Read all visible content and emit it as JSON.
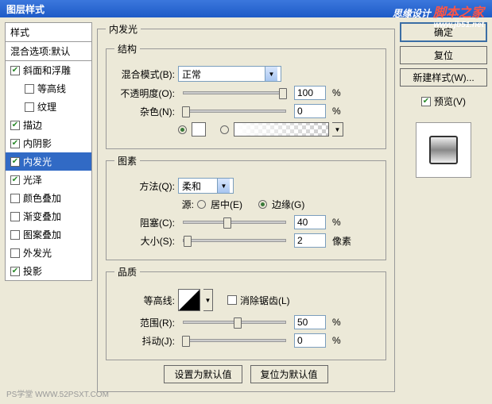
{
  "title": "图层样式",
  "watermark": {
    "text1": "思缘设计",
    "text2": "脚本之家",
    "url": "www.jb51.net"
  },
  "styles": {
    "header": "样式",
    "sub": "混合选项:默认",
    "items": [
      {
        "label": "斜面和浮雕",
        "checked": true
      },
      {
        "label": "等高线",
        "checked": false,
        "indent": true
      },
      {
        "label": "纹理",
        "checked": false,
        "indent": true
      },
      {
        "label": "描边",
        "checked": true
      },
      {
        "label": "内阴影",
        "checked": true
      },
      {
        "label": "内发光",
        "checked": true,
        "selected": true
      },
      {
        "label": "光泽",
        "checked": true
      },
      {
        "label": "颜色叠加",
        "checked": false
      },
      {
        "label": "渐变叠加",
        "checked": false
      },
      {
        "label": "图案叠加",
        "checked": false
      },
      {
        "label": "外发光",
        "checked": false
      },
      {
        "label": "投影",
        "checked": true
      }
    ]
  },
  "panel": {
    "title": "内发光",
    "structure": {
      "legend": "结构",
      "blendMode": {
        "label": "混合模式(B):",
        "value": "正常"
      },
      "opacity": {
        "label": "不透明度(O):",
        "value": "100",
        "unit": "%"
      },
      "noise": {
        "label": "杂色(N):",
        "value": "0",
        "unit": "%"
      }
    },
    "elements": {
      "legend": "图素",
      "technique": {
        "label": "方法(Q):",
        "value": "柔和"
      },
      "source": {
        "label": "源:",
        "center": "居中(E)",
        "edge": "边缘(G)"
      },
      "choke": {
        "label": "阻塞(C):",
        "value": "40",
        "unit": "%"
      },
      "size": {
        "label": "大小(S):",
        "value": "2",
        "unit": "像素"
      }
    },
    "quality": {
      "legend": "品质",
      "contour": {
        "label": "等高线:",
        "anti": "消除锯齿(L)"
      },
      "range": {
        "label": "范围(R):",
        "value": "50",
        "unit": "%"
      },
      "jitter": {
        "label": "抖动(J):",
        "value": "0",
        "unit": "%"
      }
    },
    "defaultBtn": "设置为默认值",
    "resetBtn": "复位为默认值"
  },
  "right": {
    "ok": "确定",
    "reset": "复位",
    "newStyle": "新建样式(W)...",
    "preview": "预览(V)"
  },
  "footer": "PS学堂   WWW.52PSXT.COM"
}
